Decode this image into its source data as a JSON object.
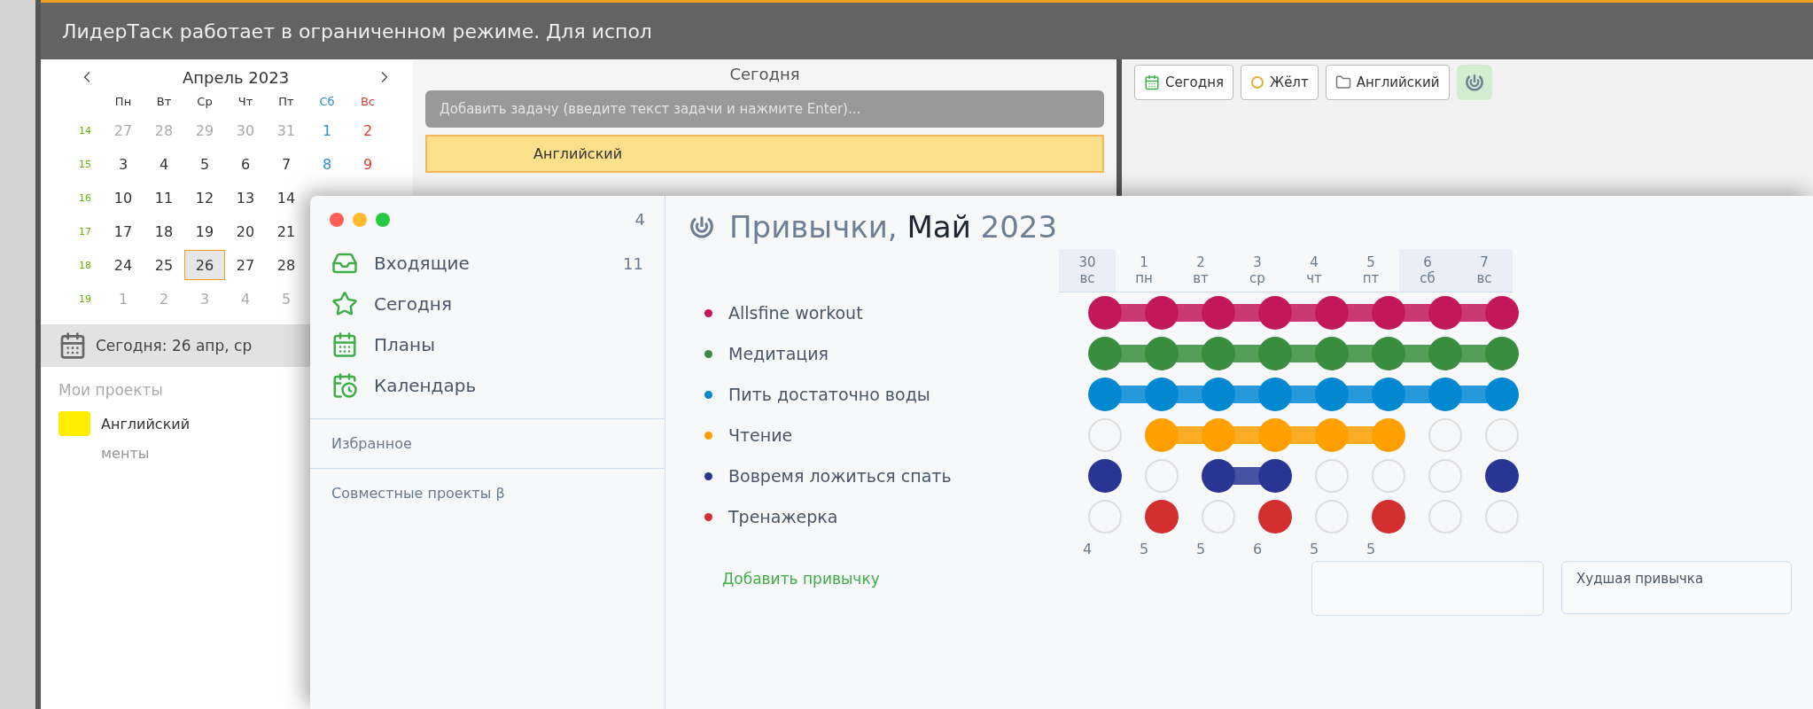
{
  "back_window": {
    "banner": "ЛидерТаск работает в ограниченном режиме. Для испол",
    "calendar": {
      "month": "Апрель 2023",
      "weekdays": [
        {
          "label": "Пн",
          "kind": "weekday"
        },
        {
          "label": "Вт",
          "kind": "weekday"
        },
        {
          "label": "Ср",
          "kind": "weekday"
        },
        {
          "label": "Чт",
          "kind": "weekday"
        },
        {
          "label": "Пт",
          "kind": "weekday"
        },
        {
          "label": "Сб",
          "kind": "saturday"
        },
        {
          "label": "Вс",
          "kind": "sunday"
        }
      ],
      "weeks": [
        {
          "number": "14",
          "days": [
            {
              "label": "27",
              "muted": true,
              "selected": false
            },
            {
              "label": "28",
              "muted": true,
              "selected": false
            },
            {
              "label": "29",
              "muted": true,
              "selected": false
            },
            {
              "label": "30",
              "muted": true,
              "selected": false
            },
            {
              "label": "31",
              "muted": true,
              "selected": false
            },
            {
              "label": "1",
              "muted": false,
              "selected": false,
              "kind": "saturday"
            },
            {
              "label": "2",
              "muted": false,
              "selected": false,
              "kind": "sunday"
            }
          ]
        },
        {
          "number": "15",
          "days": [
            {
              "label": "3",
              "muted": false,
              "selected": false
            },
            {
              "label": "4",
              "muted": false,
              "selected": false
            },
            {
              "label": "5",
              "muted": false,
              "selected": false
            },
            {
              "label": "6",
              "muted": false,
              "selected": false
            },
            {
              "label": "7",
              "muted": false,
              "selected": false
            },
            {
              "label": "8",
              "muted": false,
              "selected": false,
              "kind": "saturday"
            },
            {
              "label": "9",
              "muted": false,
              "selected": false,
              "kind": "sunday"
            }
          ]
        },
        {
          "number": "16",
          "days": [
            {
              "label": "10",
              "muted": false,
              "selected": false
            },
            {
              "label": "11",
              "muted": false,
              "selected": false
            },
            {
              "label": "12",
              "muted": false,
              "selected": false
            },
            {
              "label": "13",
              "muted": false,
              "selected": false
            },
            {
              "label": "14",
              "muted": false,
              "selected": false
            }
          ]
        },
        {
          "number": "17",
          "days": [
            {
              "label": "17",
              "muted": false,
              "selected": false
            },
            {
              "label": "18",
              "muted": false,
              "selected": false
            },
            {
              "label": "19",
              "muted": false,
              "selected": false
            },
            {
              "label": "20",
              "muted": false,
              "selected": false
            },
            {
              "label": "21",
              "muted": false,
              "selected": false
            }
          ]
        },
        {
          "number": "18",
          "days": [
            {
              "label": "24",
              "muted": false,
              "selected": false
            },
            {
              "label": "25",
              "muted": false,
              "selected": false
            },
            {
              "label": "26",
              "muted": false,
              "selected": true
            },
            {
              "label": "27",
              "muted": false,
              "selected": false
            },
            {
              "label": "28",
              "muted": false,
              "selected": false
            }
          ]
        },
        {
          "number": "19",
          "days": [
            {
              "label": "1",
              "muted": true,
              "selected": false
            },
            {
              "label": "2",
              "muted": true,
              "selected": false
            },
            {
              "label": "3",
              "muted": true,
              "selected": false
            },
            {
              "label": "4",
              "muted": true,
              "selected": false
            },
            {
              "label": "5",
              "muted": true,
              "selected": false
            }
          ]
        }
      ]
    },
    "today_label": "Сегодня: 26 апр, ср",
    "projects_heading": "Мои проекты",
    "projects": [
      {
        "name": "Английский",
        "color": "#ffee00"
      }
    ],
    "projects_more": "менты",
    "tasks": {
      "heading": "Сегодня",
      "placeholder": "Добавить задачу (введите текст задачи и нажмите Enter)...",
      "card": "Английский"
    },
    "toolbar": [
      {
        "label": "Сегодня",
        "kind": "calendar"
      },
      {
        "label": "Жёлт",
        "kind": "circle"
      },
      {
        "label": "Английский",
        "kind": "folder"
      }
    ]
  },
  "front_window": {
    "sidebar": {
      "top_count": "4",
      "items": [
        {
          "label": "Входящие",
          "kind": "inbox",
          "count": "11"
        },
        {
          "label": "Сегодня",
          "kind": "star"
        },
        {
          "label": "Планы",
          "kind": "plans"
        },
        {
          "label": "Календарь",
          "kind": "calendar"
        }
      ],
      "sections": [
        "Избранное",
        "Совместные проекты β"
      ]
    },
    "habits": {
      "title": "Привычки,",
      "month": "Май",
      "year": "2023",
      "days": [
        {
          "number": "30",
          "weekday": "вс",
          "highlighted": true
        },
        {
          "number": "1",
          "weekday": "пн",
          "highlighted": false
        },
        {
          "number": "2",
          "weekday": "вт",
          "highlighted": false
        },
        {
          "number": "3",
          "weekday": "ср",
          "highlighted": false
        },
        {
          "number": "4",
          "weekday": "чт",
          "highlighted": false
        },
        {
          "number": "5",
          "weekday": "пт",
          "highlighted": false
        },
        {
          "number": "6",
          "weekday": "сб",
          "highlighted": true
        },
        {
          "number": "7",
          "weekday": "вс",
          "highlighted": true
        }
      ],
      "items": [
        {
          "name": "Allsfine workout",
          "color": "#c2185b",
          "done": [
            true,
            true,
            true,
            true,
            true,
            true,
            true,
            true
          ]
        },
        {
          "name": "Медитация",
          "color": "#388e3c",
          "done": [
            true,
            true,
            true,
            true,
            true,
            true,
            true,
            true
          ]
        },
        {
          "name": "Пить достаточно воды",
          "color": "#0288d1",
          "done": [
            true,
            true,
            true,
            true,
            true,
            true,
            true,
            true
          ]
        },
        {
          "name": "Чтение",
          "color": "#ffa000",
          "done": [
            false,
            true,
            true,
            true,
            true,
            true,
            false,
            false
          ]
        },
        {
          "name": "Вовремя ложиться спать",
          "color": "#283593",
          "done": [
            true,
            false,
            true,
            true,
            false,
            false,
            false,
            true
          ]
        },
        {
          "name": "Тренажерка",
          "color": "#d32f2f",
          "done": [
            false,
            true,
            false,
            true,
            false,
            true,
            false,
            false
          ]
        }
      ],
      "totals": [
        "4",
        "5",
        "5",
        "6",
        "5",
        "5"
      ],
      "add_label": "Добавить привычку",
      "worst_label": "Худшая привычка"
    }
  }
}
